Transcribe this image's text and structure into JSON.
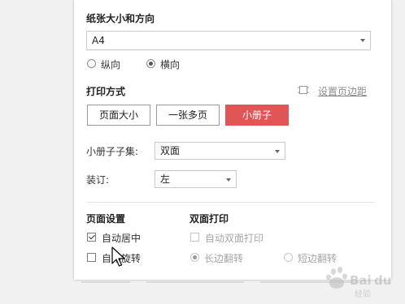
{
  "paper": {
    "title": "纸张大小和方向",
    "size_value": "A4",
    "orientation_portrait": "纵向",
    "orientation_landscape": "横向",
    "selected_orientation": "landscape"
  },
  "print_mode": {
    "title": "打印方式",
    "margin_link": "设置页边距",
    "buttons": [
      "页面大小",
      "一张多页",
      "小册子"
    ],
    "active_button": "小册子"
  },
  "booklet": {
    "subset_label": "小册子子集:",
    "subset_value": "双面",
    "binding_label": "装订:",
    "binding_value": "左"
  },
  "page_settings": {
    "title": "页面设置",
    "auto_center": "自动居中",
    "auto_center_checked": true,
    "auto_rotate": "自动旋转",
    "auto_rotate_checked": false
  },
  "duplex": {
    "title": "双面打印",
    "auto_duplex": "自动双面打印",
    "long_edge": "长边翻转",
    "short_edge": "短边翻转",
    "selected": "long_edge"
  },
  "watermark_text": "Baidu经验",
  "colors": {
    "accent": "#e05555",
    "panel_bg": "#ffffff",
    "page_bg": "#f1f1f1"
  }
}
